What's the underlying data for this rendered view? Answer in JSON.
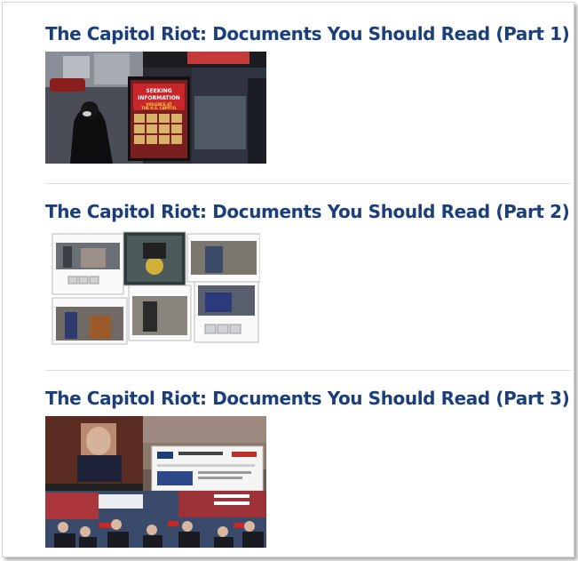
{
  "articles": [
    {
      "title": "The Capitol Riot: Documents You Should Read (Part 1)",
      "sign": [
        "SEEKING",
        "INFORMATION",
        "VIOLENCE AT",
        "THE U.S. CAPITOL"
      ]
    },
    {
      "title": "The Capitol Riot: Documents You Should Read (Part 2)"
    },
    {
      "title": "The Capitol Riot: Documents You Should Read (Part 3)"
    }
  ]
}
